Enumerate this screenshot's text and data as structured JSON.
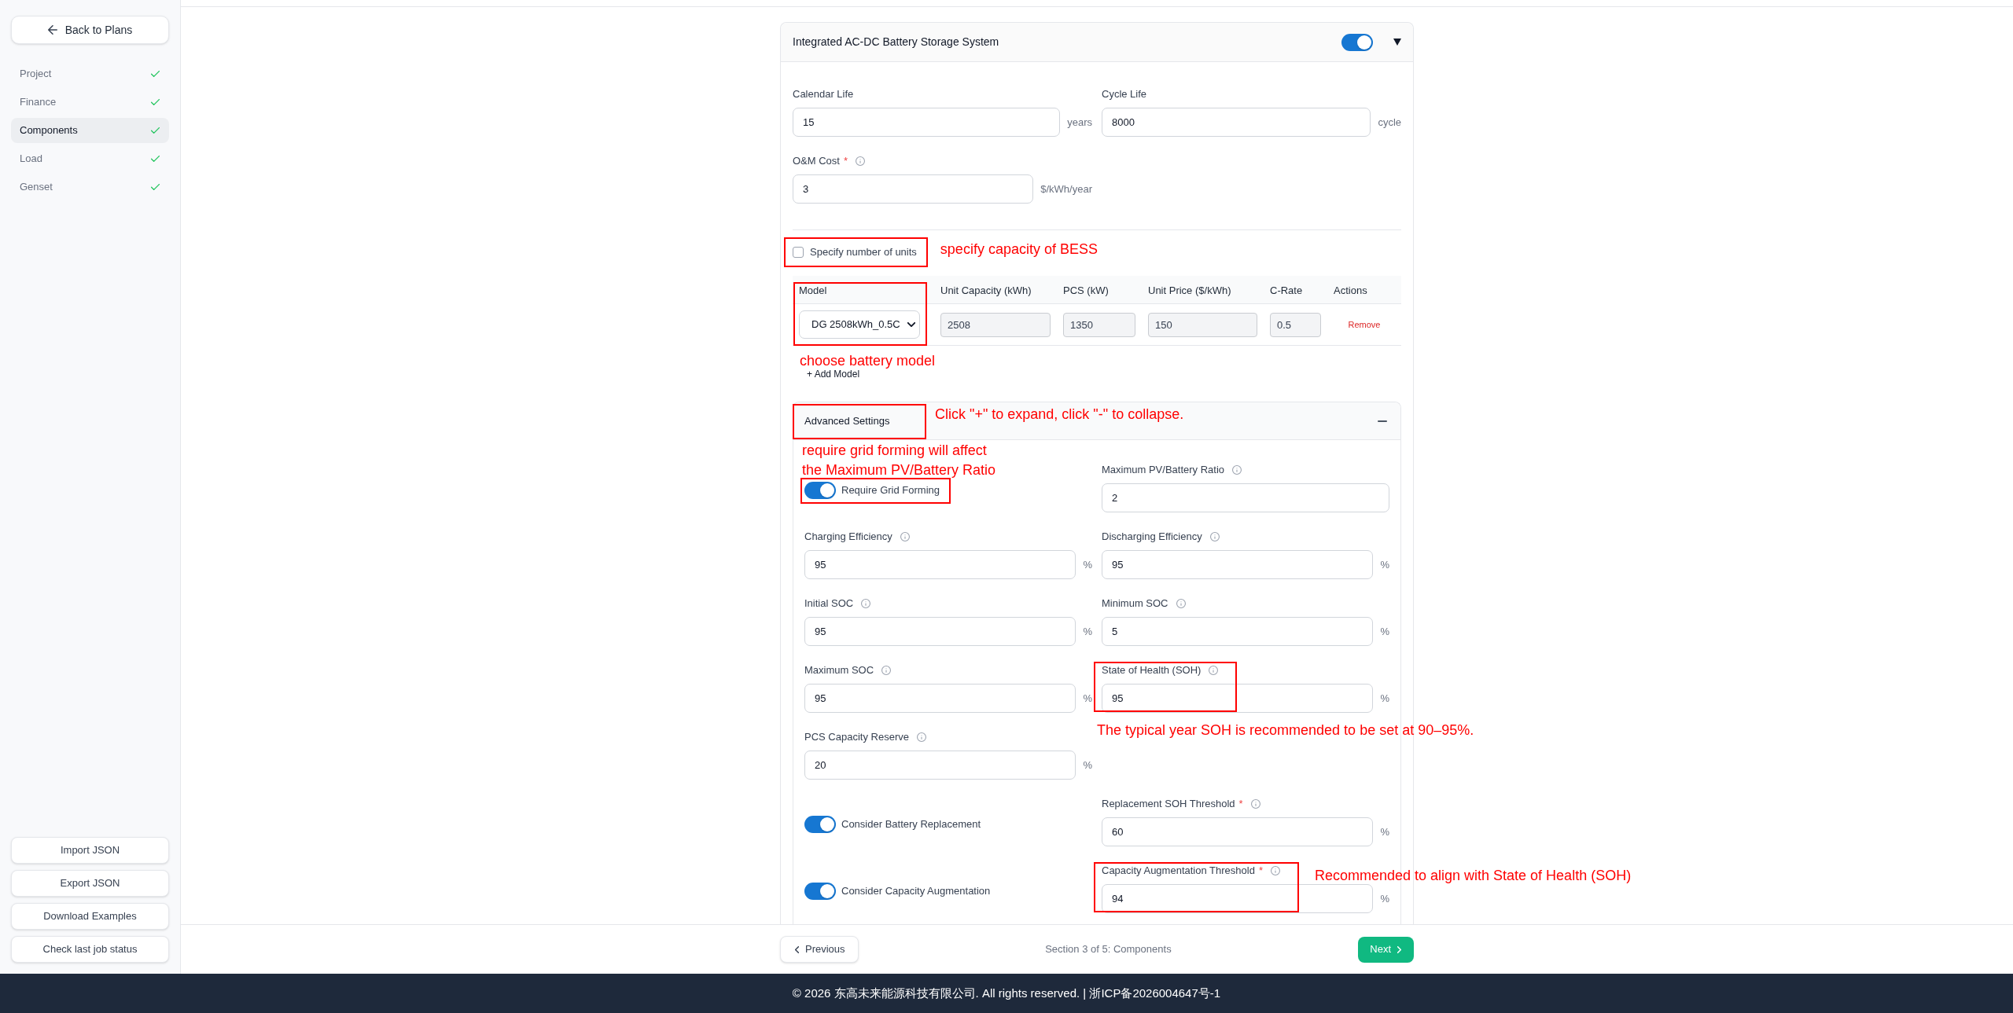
{
  "sidebar": {
    "back_button": "Back to Plans",
    "steps": [
      {
        "label": "Project",
        "selected": false,
        "complete": true
      },
      {
        "label": "Finance",
        "selected": false,
        "complete": true
      },
      {
        "label": "Components",
        "selected": true,
        "complete": true
      },
      {
        "label": "Load",
        "selected": false,
        "complete": true
      },
      {
        "label": "Genset",
        "selected": false,
        "complete": true
      }
    ],
    "actions": [
      "Import JSON",
      "Export JSON",
      "Download Examples",
      "Check last job status"
    ]
  },
  "component": {
    "title": "Integrated AC-DC Battery Storage System",
    "enabled": true,
    "expanded": true,
    "fields": [
      {
        "label": "Calendar Life",
        "info": false,
        "value": "15",
        "unit": "years"
      },
      {
        "label": "Cycle Life",
        "info": false,
        "value": "8000",
        "unit": "cycle"
      },
      {
        "label": "O&M Cost",
        "required_mark": "*",
        "info": true,
        "value": "3",
        "unit": "$/kWh/year"
      }
    ],
    "units_option": {
      "label": "Specify number of units",
      "checked": false,
      "highlighted": true,
      "note": "specify capacity of BESS"
    },
    "models_table": {
      "columns": [
        "Model",
        "Unit Capacity (kWh)",
        "PCS (kW)",
        "Unit Price ($/kWh)",
        "C-Rate",
        "Actions"
      ],
      "rows": [
        {
          "model": "DG 2508kWh_0.5C",
          "values": [
            "2508",
            "1350",
            "150",
            "0.5"
          ],
          "action": "Remove"
        }
      ],
      "model_highlighted": true,
      "note": "choose battery model",
      "add_button": "+ Add Model"
    },
    "advanced_settings": {
      "title": "Advanced Settings",
      "expanded": true,
      "highlighted": true,
      "note": "Click \"+\" to expand, click \"-\" to collapse.",
      "rows": [
        [
          {
            "kind": "toggle",
            "label": "Require Grid Forming",
            "on": true,
            "highlighted": true,
            "note": "require grid forming will affect the Maximum PV/Battery Ratio"
          },
          {
            "kind": "field",
            "label": "Maximum PV/Battery Ratio",
            "info": true,
            "value": "2",
            "highlighted": false
          }
        ],
        [
          {
            "kind": "field",
            "label": "Charging Efficiency",
            "info": true,
            "value": "95",
            "unit": "%",
            "highlighted": false
          },
          {
            "kind": "field",
            "label": "Discharging Efficiency",
            "info": true,
            "value": "95",
            "unit": "%",
            "highlighted": false
          }
        ],
        [
          {
            "kind": "field",
            "label": "Initial SOC",
            "info": true,
            "value": "95",
            "unit": "%",
            "highlighted": false
          },
          {
            "kind": "field",
            "label": "Minimum SOC",
            "info": true,
            "value": "5",
            "unit": "%",
            "highlighted": false
          }
        ],
        [
          {
            "kind": "field",
            "label": "Maximum SOC",
            "info": true,
            "value": "95",
            "unit": "%",
            "highlighted": false
          },
          {
            "kind": "field",
            "label": "State of Health (SOH)",
            "info": true,
            "value": "95",
            "unit": "%",
            "highlighted": true,
            "note_below": "The typical year SOH is recommended to be set at 90–95%."
          }
        ],
        [
          {
            "kind": "field",
            "label": "PCS Capacity Reserve",
            "info": true,
            "value": "20",
            "unit": "%",
            "highlighted": false
          }
        ],
        [
          {
            "kind": "toggle",
            "label": "Consider Battery Replacement",
            "on": true,
            "highlighted": false
          },
          {
            "kind": "field",
            "label": "Replacement SOH Threshold",
            "required_mark": "*",
            "info": true,
            "value": "60",
            "unit": "%",
            "highlighted": false
          }
        ],
        [
          {
            "kind": "toggle",
            "label": "Consider Capacity Augmentation",
            "on": true,
            "highlighted": false
          },
          {
            "kind": "field",
            "label": "Capacity Augmentation Threshold",
            "required_mark": "*",
            "info": true,
            "value": "94",
            "unit": "%",
            "highlighted": true,
            "note_right": "Recommended to align with State of Health (SOH)"
          }
        ]
      ]
    }
  },
  "pager": {
    "previous": "Previous",
    "status": "Section 3 of 5: Components",
    "next": "Next"
  },
  "footer": {
    "copyright": "© 2026 东高未来能源科技有限公司. All rights reserved. | 浙ICP备2026004647号-1"
  }
}
